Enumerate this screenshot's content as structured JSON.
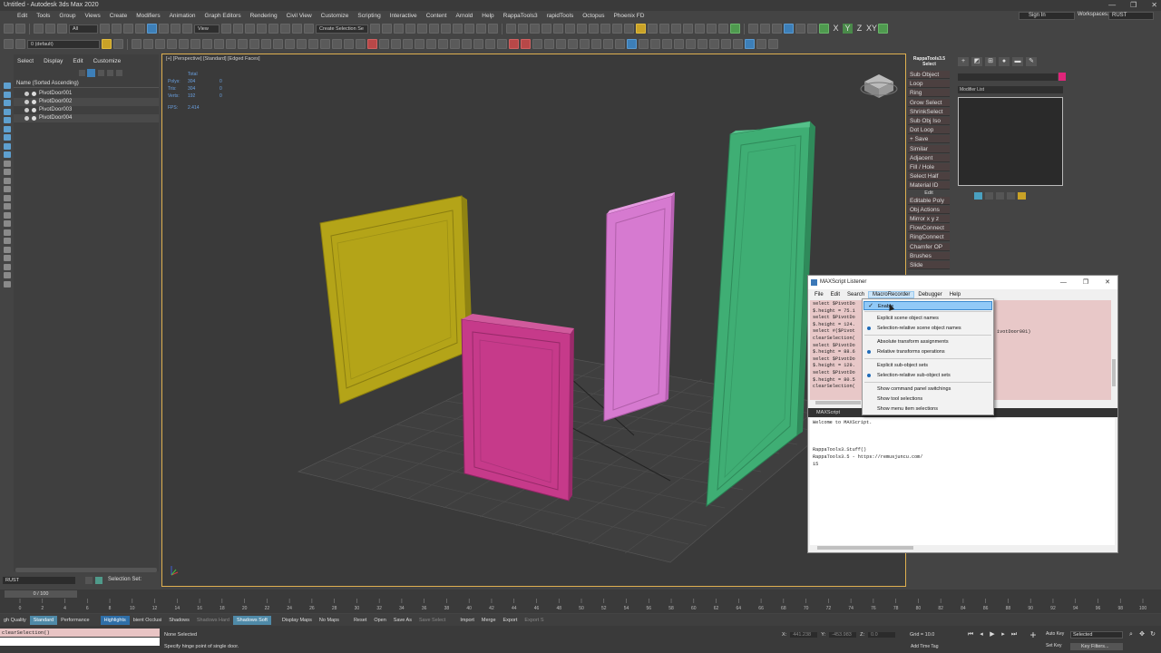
{
  "app": {
    "title": "Untitled - Autodesk 3ds Max 2020",
    "window_controls": [
      "—",
      "❐",
      "✕"
    ]
  },
  "menubar": {
    "items": [
      "Edit",
      "Tools",
      "Group",
      "Views",
      "Create",
      "Modifiers",
      "Animation",
      "Graph Editors",
      "Rendering",
      "Civil View",
      "Customize",
      "Scripting",
      "Interactive",
      "Content",
      "Arnold",
      "Help",
      "RappaTools3",
      "rapidTools",
      "Octopus",
      "Phoenix FD"
    ],
    "sign_in": "Sign In",
    "workspaces_label": "Workspaces:",
    "workspace_value": "RUST"
  },
  "toolbar": {
    "filter": "All",
    "view": "View",
    "selection_set": "Create Selection Se",
    "layer": "0 (default)"
  },
  "scene_explorer": {
    "menu": [
      "Select",
      "Display",
      "Edit",
      "Customize"
    ],
    "header": "Name (Sorted Ascending)",
    "rows": [
      "PivotDoor001",
      "PivotDoor002",
      "PivotDoor003",
      "PivotDoor004"
    ]
  },
  "viewport": {
    "label": "[+] [Perspective] [Standard] [Edged Faces]",
    "stats": {
      "total_label": "Total",
      "polys_label": "Polys:",
      "polys_total": "304",
      "polys_sel": "0",
      "tris_label": "Tris:",
      "tris_total": "304",
      "tris_sel": "0",
      "verts_label": "Verts:",
      "verts_total": "192",
      "verts_sel": "0",
      "fps_label": "FPS:",
      "fps_value": "2.414"
    }
  },
  "rappa": {
    "title_line1": "RappaTools3.5",
    "title_line2": "Select",
    "buttons_select": [
      "Sub Object",
      "Loop",
      "Ring",
      "Grow Select",
      "ShrinkSelect",
      "Sub Obj Iso",
      "Dot Loop",
      "+ Save",
      "Similar",
      "Adjacent",
      "Fill / Hole",
      "Select Half",
      "Material ID"
    ],
    "edit_label": "Edit",
    "buttons_edit": [
      "Editable Poly",
      "Obj Actions",
      "Mirror  x  y  z",
      "FlowConnect",
      "RingConnect",
      "Chamfer OP",
      "Brushes",
      "Slide"
    ]
  },
  "command_panel": {
    "modifier_list": "Modifier List"
  },
  "listener": {
    "title": "MAXScript Listener",
    "menu": [
      "File",
      "Edit",
      "Search",
      "MacroRecorder",
      "Debugger",
      "Help"
    ],
    "active_menu": "MacroRecorder",
    "macro_lines": [
      "select $PivotDo",
      "$.height = 75.1",
      "select $PivotDo",
      "$.height = 124.",
      "select #($Pivot",
      "clearSelection(",
      "select $PivotDo",
      "$.height = 88.6",
      "select $PivotDo",
      "$.height = 129.",
      "select $PivotDo",
      "$.height = 80.5",
      "clearSelection("
    ],
    "macro_tail": "ivotDoor001)",
    "pane_label": "MAXScript",
    "script_lines": [
      "Welcome to MAXScript.",
      "",
      "",
      "",
      "RappaTools3.Stuff()",
      "RappaTools3.5 - https://remusjuncu.com/",
      "15"
    ]
  },
  "dropdown": {
    "items": [
      {
        "label": "Enable",
        "state": "check",
        "highlight": true
      },
      {
        "label": "Explicit scene object names",
        "state": "none"
      },
      {
        "label": "Selection-relative scene object names",
        "state": "radio"
      },
      {
        "label": "Absolute transform assignments",
        "state": "none"
      },
      {
        "label": "Relative transforms operations",
        "state": "radio"
      },
      {
        "label": "Explicit sub-object sets",
        "state": "none"
      },
      {
        "label": "Selection-relative sub-object sets",
        "state": "radio"
      },
      {
        "label": "Show command panel switchings",
        "state": "none"
      },
      {
        "label": "Show tool selections",
        "state": "none"
      },
      {
        "label": "Show menu item selections",
        "state": "none"
      }
    ]
  },
  "layerbar": {
    "layer": "RUST",
    "selection_sets": "Selection Set:"
  },
  "timeline": {
    "frame_counter": "0 / 100",
    "ticks": [
      "0",
      "2",
      "4",
      "6",
      "8",
      "10",
      "12",
      "14",
      "16",
      "18",
      "20",
      "22",
      "24",
      "26",
      "28",
      "30",
      "32",
      "34",
      "36",
      "38",
      "40",
      "42",
      "44",
      "46",
      "48",
      "50",
      "52",
      "54",
      "56",
      "58",
      "60",
      "62",
      "64",
      "66",
      "68",
      "70",
      "72",
      "74",
      "76",
      "78",
      "80",
      "82",
      "84",
      "86",
      "88",
      "90",
      "92",
      "94",
      "96",
      "98",
      "100"
    ]
  },
  "quickbar": {
    "items": [
      {
        "label": "gh Quality",
        "style": ""
      },
      {
        "label": "Standard",
        "style": "on"
      },
      {
        "label": "Performance",
        "style": ""
      },
      {
        "label": "Highlights",
        "style": "b"
      },
      {
        "label": "bient Occlusi",
        "style": ""
      },
      {
        "label": "Shadows",
        "style": ""
      },
      {
        "label": "Shadows Hard",
        "style": "dim"
      },
      {
        "label": "Shadows Soft",
        "style": "on"
      },
      {
        "label": "Display Maps",
        "style": ""
      },
      {
        "label": "No Maps",
        "style": ""
      },
      {
        "label": "Reset",
        "style": ""
      },
      {
        "label": "Open",
        "style": ""
      },
      {
        "label": "Save As",
        "style": ""
      },
      {
        "label": "Save Select",
        "style": "dim"
      },
      {
        "label": "Import",
        "style": ""
      },
      {
        "label": "Merge",
        "style": ""
      },
      {
        "label": "Export",
        "style": ""
      },
      {
        "label": "Export S",
        "style": "dim"
      }
    ]
  },
  "status": {
    "script_input": "clearSelection()",
    "line1": "None Selected",
    "line2": "Specify hinge point of single door.",
    "x_label": "X:",
    "x_value": "441.238",
    "y_label": "Y:",
    "y_value": "-453.983",
    "z_label": "Z:",
    "z_value": "0.0",
    "grid": "Grid = 10.0",
    "add_time_tag": "Add Time Tag",
    "auto_key": "Auto Key",
    "set_key": "Set Key",
    "selected": "Selected",
    "key_filters": "Key Filters..."
  },
  "colors": {
    "door_yellow": "#b4a418",
    "door_pink": "#c63a8a",
    "door_magenta": "#d67ad0",
    "door_green": "#3fae74",
    "viewport_border": "#e0b050"
  }
}
